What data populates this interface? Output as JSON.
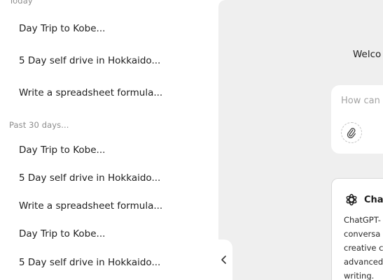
{
  "sidebar": {
    "sections": [
      {
        "label": "Today",
        "items": [
          "Day Trip to Kobe...",
          "5 Day self drive in Hokkaido...",
          "Write a spreadsheet formula..."
        ]
      },
      {
        "label": "Past 30 days...",
        "items": [
          "Day Trip to Kobe...",
          "5 Day self drive in Hokkaido...",
          "Write a spreadsheet formula...",
          "Day Trip to Kobe...",
          "5 Day self drive in Hokkaido..."
        ]
      }
    ]
  },
  "main": {
    "welcome": "Welco",
    "prompt": {
      "placeholder": "How can"
    },
    "info_card": {
      "title": "Cha",
      "lines": [
        "ChatGPT-",
        "conversa",
        "creative c",
        "advanced",
        "writing."
      ]
    }
  },
  "icons": {
    "collapse": "chevron-left-icon",
    "attach": "paperclip-icon",
    "openai": "openai-logo-icon"
  }
}
